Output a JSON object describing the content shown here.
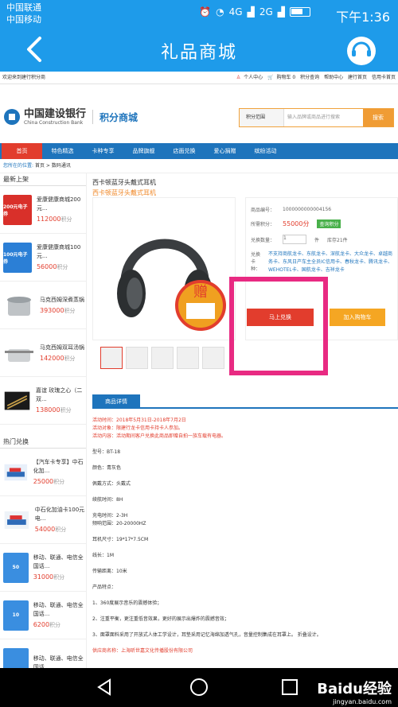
{
  "status_bar": {
    "carrier1": "中国联通",
    "carrier2": "中国移动",
    "network1": "4G",
    "network2": "2G",
    "time": "下午1:36"
  },
  "app_bar": {
    "title": "礼品商城"
  },
  "web": {
    "top_strip": {
      "welcome": "欢迎来到建行积分商",
      "personal": "个人中心",
      "cart": "购物车 0",
      "points_query": "积分查询",
      "help": "帮助中心",
      "ccb": "建行首页",
      "card_home": "信用卡首页"
    },
    "logo": {
      "bank_cn": "中国建设银行",
      "bank_en": "China Construction Bank",
      "mall": "积分商城"
    },
    "search": {
      "scope": "积分范围",
      "placeholder": "输入品牌或商品进行搜索",
      "button": "搜索"
    },
    "nav": [
      "首页",
      "特色精选",
      "卡种专享",
      "品牌旗舰",
      "店面兑换",
      "爱心捐赠",
      "缤纷活动"
    ],
    "breadcrumb": {
      "label": "您所在的位置:",
      "home": "首页",
      "category": "数码通讯"
    },
    "sidebar": {
      "new_title": "最新上架",
      "new_items": [
        {
          "name": "爱康健康商城200元...",
          "points": "112000",
          "unit": "积分",
          "card_text": "200元电子券"
        },
        {
          "name": "爱康健康商城100元...",
          "points": "56000",
          "unit": "积分",
          "card_text": "100元电子券"
        },
        {
          "name": "马克西姆深煮蒸锅",
          "points": "393000",
          "unit": "积分"
        },
        {
          "name": "马克西姆双耳汤锅",
          "points": "142000",
          "unit": "积分"
        },
        {
          "name": "嘉谊 玫瑰之心（二双...",
          "points": "138000",
          "unit": "积分"
        }
      ],
      "hot_title": "热门兑换",
      "hot_items": [
        {
          "name": "【汽车卡专享】中石化加...",
          "points": "25000",
          "unit": "积分"
        },
        {
          "name": "中石化加油卡100元电...",
          "points": "54000",
          "unit": "积分"
        },
        {
          "name": "移动、联通、电信全国话...",
          "points": "31000",
          "unit": "积分",
          "card_text": "50"
        },
        {
          "name": "移动、联通、电信全国话...",
          "points": "6200",
          "unit": "积分",
          "card_text": "10"
        },
        {
          "name": "移动、联通、电信全国话...",
          "points": "",
          "unit": ""
        }
      ]
    },
    "product": {
      "title": "西卡顿蓝牙头戴式耳机",
      "subtitle": "西卡顿蓝牙头戴式耳机",
      "gift": "赠",
      "code_label": "商品编号：",
      "code": "1000000000004156",
      "points_label": "所需积分：",
      "points": "55000分",
      "tag": "查询积分",
      "qty_label": "兑换数量：",
      "qty": "1",
      "qty_unit": "件",
      "stock": "库存21件",
      "cards_label": "兑换卡种：",
      "cards": "不支持商航龙卡、东航龙卡、深航龙卡、大众龙卡、卓越商务卡、东风日产车主全员IC信用卡、春秋龙卡、腾讯龙卡、WEHOTEL卡、国航龙卡、吉祥龙卡",
      "exchange_button": "马上兑换",
      "cart_button": "加入购物车",
      "detail_tab": "商品详情"
    },
    "description": {
      "activity_time": "活动时间：2018年5月31日-2018年7月2日",
      "activity_target": "活动对象：限建行龙卡信用卡持卡人参加。",
      "activity_content": "活动内容：活动期间客户兑换此商品即赠自拍一族车载有电器。",
      "model": "型号：BT-18",
      "color": "颜色：青灰色",
      "style": "佩戴方式：头戴式",
      "battery": "续航时间：8H",
      "charge": "充电时间：2-3H",
      "freq": "频响范围：20-20000HZ",
      "size": "耳机尺寸：19*17*7.5CM",
      "cable": "线长：1M",
      "distance": "传输距离：10米",
      "features_title": "产品特点：",
      "f1": "1、360度展示音乐的震撼体验；",
      "f2": "2、注重平衡，更注重低音效果，更好的展示出爆炸的震撼音效；",
      "f3": "3、面罩面料采用了开放式人体工学设计，耳垫采用记忆海绵加透气孔，音量控制集成在耳罩上。 折叠设计。",
      "supplier": "供应商名称：上海昕世嘉文化传播股份有限公司"
    }
  },
  "watermark": {
    "brand": "Baidu经验",
    "url": "jingyan.baidu.com"
  }
}
